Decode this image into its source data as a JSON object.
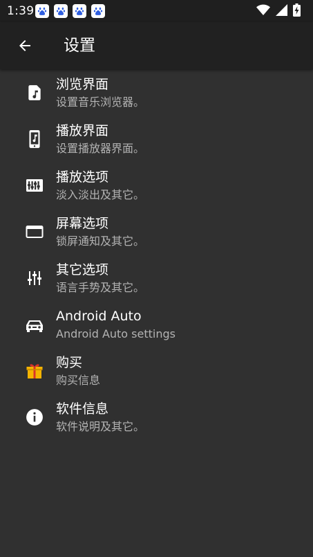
{
  "status_bar": {
    "time": "1:39",
    "notification_icons": [
      "baidu-paw-icon",
      "baidu-paw-icon",
      "baidu-paw-icon",
      "baidu-paw-icon"
    ],
    "right_icons": [
      "wifi-icon",
      "signal-icon",
      "battery-charging-icon"
    ]
  },
  "app_bar": {
    "title": "设置",
    "back_icon": "arrow-back-icon"
  },
  "settings": {
    "items": [
      {
        "icon": "music-file-icon",
        "title": "浏览界面",
        "subtitle": "设置音乐浏览器。"
      },
      {
        "icon": "phone-music-icon",
        "title": "播放界面",
        "subtitle": "设置播放器界面。"
      },
      {
        "icon": "equalizer-icon",
        "title": "播放选项",
        "subtitle": "淡入淡出及其它。"
      },
      {
        "icon": "window-icon",
        "title": "屏幕选项",
        "subtitle": "锁屏通知及其它。"
      },
      {
        "icon": "tune-sliders-icon",
        "title": "其它选项",
        "subtitle": "语言手势及其它。"
      },
      {
        "icon": "car-icon",
        "title": "Android Auto",
        "subtitle": "Android Auto settings"
      },
      {
        "icon": "gift-icon",
        "title": "购买",
        "subtitle": "购买信息"
      },
      {
        "icon": "info-icon",
        "title": "软件信息",
        "subtitle": "软件说明及其它。"
      }
    ]
  },
  "colors": {
    "background": "#303030",
    "app_bar": "#212121",
    "status_bar": "#1f1f1f",
    "primary_text": "#ffffff",
    "secondary_text": "#b3b3b3",
    "gift_accent": "#f5b400"
  }
}
